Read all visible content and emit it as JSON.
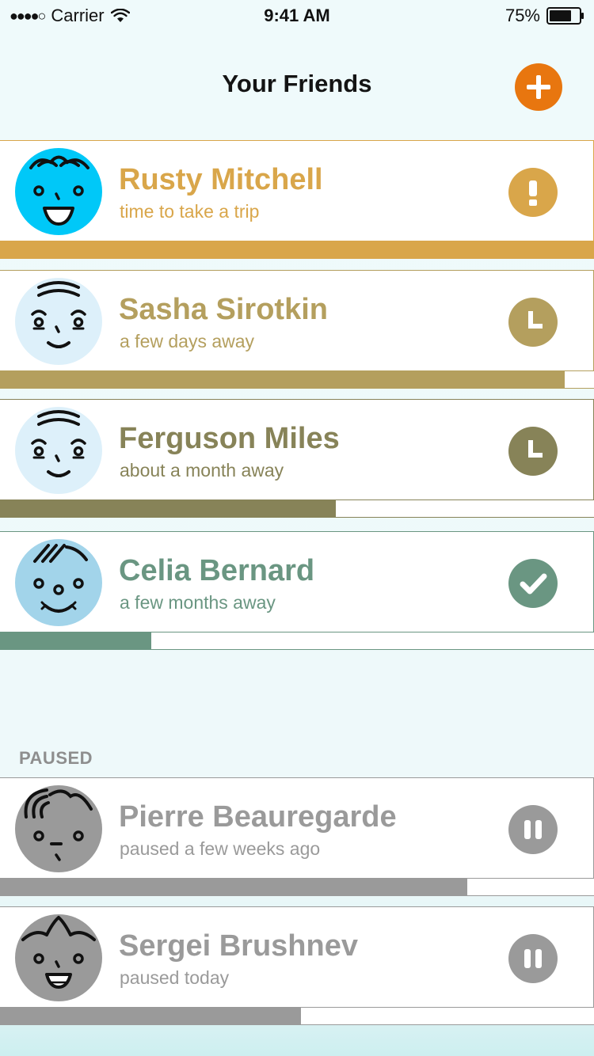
{
  "status_bar": {
    "signal_dots": "●●●●○",
    "carrier": "Carrier",
    "time": "9:41 AM",
    "battery": "75%",
    "battery_level": 0.75
  },
  "header": {
    "title": "Your Friends",
    "add_icon": "plus-icon",
    "add_color": "#e8760f"
  },
  "friends": [
    {
      "name": "Rusty Mitchell",
      "subtitle": "time to take a trip",
      "status_icon": "exclamation-icon",
      "accent": "#d9a64a",
      "progress": 1.0
    },
    {
      "name": "Sasha Sirotkin",
      "subtitle": "a few days away",
      "status_icon": "clock-icon",
      "accent": "#b49f5e",
      "progress": 0.95
    },
    {
      "name": "Ferguson Miles",
      "subtitle": "about a month away",
      "status_icon": "clock-icon",
      "accent": "#878358",
      "progress": 0.565
    },
    {
      "name": "Celia Bernard",
      "subtitle": "a few months away",
      "status_icon": "checkmark-icon",
      "accent": "#6a9682",
      "progress": 0.255
    }
  ],
  "paused_section": {
    "label": "PAUSED",
    "friends": [
      {
        "name": "Pierre Beauregarde",
        "subtitle": "paused a few weeks ago",
        "status_icon": "pause-icon",
        "accent": "#9a9a9a",
        "progress": 0.787
      },
      {
        "name": "Sergei Brushnev",
        "subtitle": "paused today",
        "status_icon": "pause-icon",
        "accent": "#9a9a9a",
        "progress": 0.507
      }
    ]
  }
}
